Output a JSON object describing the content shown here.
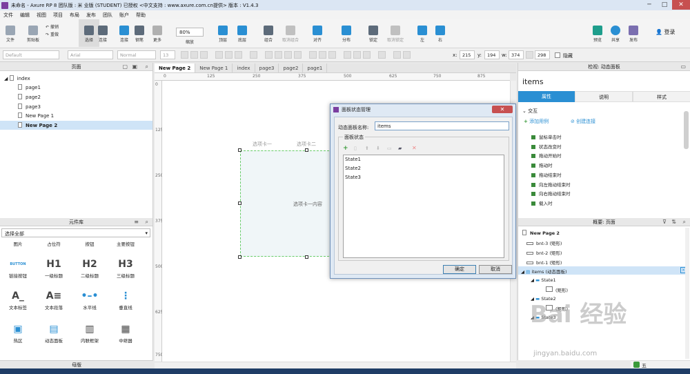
{
  "window": {
    "title": "未命名 - Axure RP 8 团队版 : 米 业版 (STUDENT) 已授权  <中文支持 : www.axure.com.cn提供> 版本 : V1.4.3",
    "minimize": "─",
    "maximize": "□",
    "close": "✕"
  },
  "menu": [
    "文件",
    "编辑",
    "视图",
    "项目",
    "布局",
    "发布",
    "团队",
    "账户",
    "帮助"
  ],
  "toolbar": {
    "file": "文件",
    "clipboard": "剪贴板",
    "cut": "剪切",
    "copy": "复制",
    "undo": "撤销",
    "redo": "重做",
    "select": "选择",
    "connect": "连接",
    "pen": "钢笔",
    "more": "更多",
    "zoom_value": "80%",
    "zoom_label": "缩放",
    "top": "顶层",
    "bottom": "底层",
    "group": "组合",
    "ungroup": "取消组合",
    "align": "对齐",
    "distribute": "分布",
    "lock": "锁定",
    "unlock": "取消锁定",
    "left": "左",
    "right": "右",
    "preview": "预览",
    "share": "共享",
    "publish": "发布",
    "login": "登录"
  },
  "format": {
    "style": "Default",
    "font": "Arial",
    "weight": "Normal",
    "size": "13",
    "x_label": "x:",
    "x": "215",
    "y_label": "y:",
    "y": "194",
    "w_label": "w:",
    "w": "374",
    "h": "298",
    "hidden": "隐藏"
  },
  "pages_panel": {
    "title": "页面",
    "items": [
      "index",
      "page1",
      "page2",
      "page3",
      "New Page 1",
      "New Page 2"
    ]
  },
  "library": {
    "title": "元件库",
    "filter": "选择全部",
    "top_row": [
      "图片",
      "占位符",
      "按钮",
      "主要按钮"
    ],
    "row2": [
      {
        "glyph": "BUTTON",
        "label": "链接按钮"
      },
      {
        "glyph": "H1",
        "label": "一级标题"
      },
      {
        "glyph": "H2",
        "label": "二级标题"
      },
      {
        "glyph": "H3",
        "label": "三级标题"
      }
    ],
    "row3": [
      {
        "glyph": "A_",
        "label": "文本标签"
      },
      {
        "glyph": "A≡",
        "label": "文本段落"
      },
      {
        "glyph": "•–•",
        "label": "水平线"
      },
      {
        "glyph": "⋮",
        "label": "垂直线"
      }
    ],
    "row4": [
      {
        "glyph": "▣",
        "label": "热区"
      },
      {
        "glyph": "▤",
        "label": "动态面板"
      },
      {
        "glyph": "▥",
        "label": "内联框架"
      },
      {
        "glyph": "▦",
        "label": "中继器"
      }
    ]
  },
  "masters": {
    "title": "母版"
  },
  "tabs": [
    "New Page 2",
    "New Page 1",
    "index",
    "page3",
    "page2",
    "page1"
  ],
  "ruler": {
    "top": [
      "0",
      "125",
      "250",
      "375",
      "500",
      "625",
      "750",
      "875"
    ],
    "left": [
      "0",
      "125",
      "250",
      "375",
      "500",
      "625",
      "750"
    ]
  },
  "canvas": {
    "tab1": "选项卡一",
    "tab2": "选项卡二",
    "content": "选项卡一内容"
  },
  "dialog": {
    "title": "面板状态管理",
    "name_label": "动态面板名称:",
    "name_value": "items",
    "group_label": "面板状态",
    "states": [
      "State1",
      "State2",
      "State3"
    ],
    "ok": "确定",
    "cancel": "取消"
  },
  "inspector": {
    "header": "检视: 动态面板",
    "name": "items",
    "tabs": [
      "属性",
      "说明",
      "样式"
    ],
    "section": "交互",
    "add_case": "添加用例",
    "create_link": "创建连接",
    "events": [
      "鼠标单击时",
      "状态改变时",
      "拖动开始时",
      "拖动时",
      "拖动结束时",
      "向左拖动结束时",
      "向右拖动结束时",
      "载入时"
    ]
  },
  "outline": {
    "header": "概要: 页面",
    "page": "New Page 2",
    "items": [
      "bnt-3 (矩形)",
      "bnt-2 (矩形)",
      "bnt-1 (矩形)",
      "items (动态面板)",
      "State1",
      "(矩形)",
      "State2",
      "(矩形)",
      "State3"
    ]
  },
  "watermark": {
    "brand": "Bai 经验",
    "url": "jingyan.baidu.com"
  },
  "status": {
    "ime": "五"
  },
  "colors": {
    "accent": "#2a8fd3",
    "selection": "#66cc66",
    "dialog_border": "#6e8fb8"
  }
}
